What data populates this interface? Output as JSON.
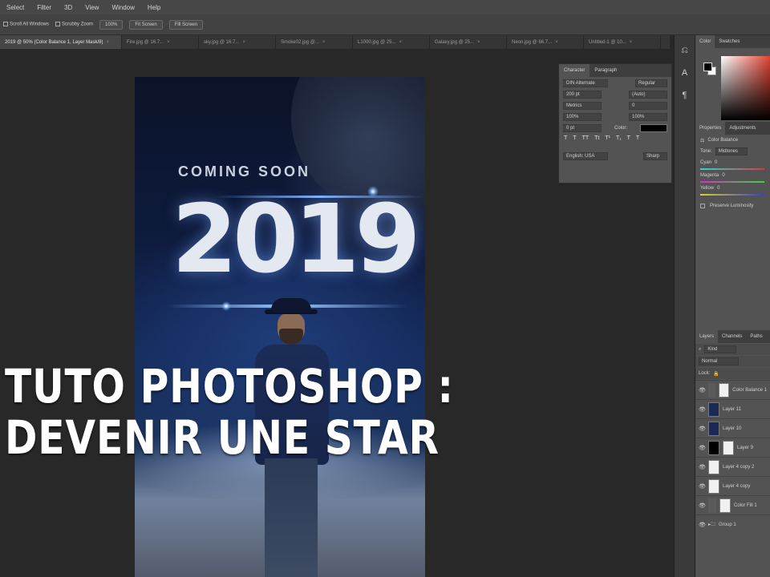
{
  "menu": [
    "Select",
    "Filter",
    "3D",
    "View",
    "Window",
    "Help"
  ],
  "options": {
    "zoom_label": "Scroll All Windows",
    "fit_screen": "Fit Screen",
    "fill_screen": "Fill Screen",
    "percent": "100%",
    "scrubby": "Scrubby Zoom"
  },
  "tabs": [
    {
      "label": "2019 @ 50% (Color Balance 1, Layer Mask/8)",
      "active": true
    },
    {
      "label": "Fire.jpg @ 16.7...",
      "active": false
    },
    {
      "label": "sky.jpg @ 16.7...",
      "active": false
    },
    {
      "label": "Smoke02.jpg @...",
      "active": false
    },
    {
      "label": "L1000.jpg @ 25...",
      "active": false
    },
    {
      "label": "Galaxy.jpg @ 25...",
      "active": false
    },
    {
      "label": "Neon.jpg @ 66.7...",
      "active": false
    },
    {
      "label": "Untitled-1 @ 10...",
      "active": false
    }
  ],
  "poster": {
    "coming_soon": "COMING SOON",
    "year": "2019"
  },
  "overlay": {
    "line1": "TUTO PHOTOSHOP :",
    "line2": "DEVENIR UNE STAR"
  },
  "character_panel": {
    "tab_character": "Character",
    "tab_paragraph": "Paragraph",
    "font_family": "DIN Alternate",
    "font_style": "Regular",
    "font_size": "200 pt",
    "leading": "(Auto)",
    "kerning": "Metrics",
    "tracking": "0",
    "vscale": "100%",
    "hscale": "100%",
    "baseline": "0 pt",
    "color_label": "Color:",
    "language": "English: USA",
    "antialias": "Sharp",
    "glyphs": [
      "T",
      "T",
      "TT",
      "Tt",
      "T¹",
      "T₁",
      "T",
      "T"
    ]
  },
  "color_panel": {
    "tab_color": "Color",
    "tab_swatches": "Swatches"
  },
  "properties_panel": {
    "tab_properties": "Properties",
    "tab_adjustments": "Adjustments",
    "title": "Color Balance",
    "tone_label": "Tone:",
    "tone_value": "Midtones",
    "sliders": [
      {
        "name": "Cyan",
        "value": "0"
      },
      {
        "name": "Magenta",
        "value": "0"
      },
      {
        "name": "Yellow",
        "value": "0"
      }
    ],
    "preserve": "Preserve Luminosity"
  },
  "layers_panel": {
    "tab_layers": "Layers",
    "tab_channels": "Channels",
    "tab_paths": "Paths",
    "filter_kind": "Kind",
    "blend_mode": "Normal",
    "lock_label": "Lock:",
    "layers": [
      {
        "name": "Color Balance 1",
        "thumb": "adj"
      },
      {
        "name": "Layer 11",
        "thumb": "photo"
      },
      {
        "name": "Layer 10",
        "thumb": "photo"
      },
      {
        "name": "Layer 9",
        "thumb": "black"
      },
      {
        "name": "Layer 4 copy 2",
        "thumb": "white"
      },
      {
        "name": "Layer 4 copy",
        "thumb": "white"
      },
      {
        "name": "Color Fill 1",
        "thumb": "adj"
      },
      {
        "name": "Group 1",
        "thumb": "group"
      }
    ]
  }
}
